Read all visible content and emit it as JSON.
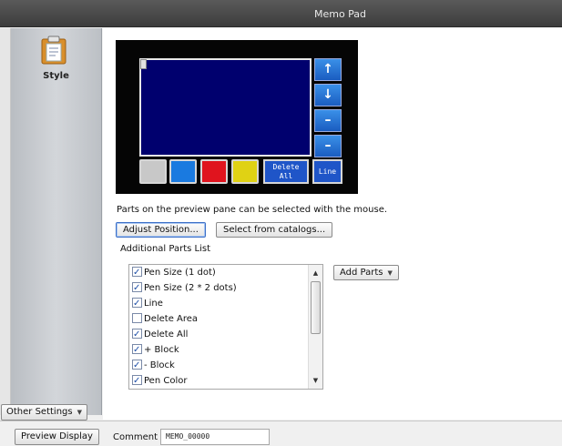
{
  "window": {
    "title": "Memo Pad"
  },
  "sidebar": {
    "style_label": "Style",
    "other_settings_label": "Other Settings"
  },
  "preview": {
    "delete_all_line1": "Delete",
    "delete_all_line2": "All",
    "line_label": "Line",
    "color_buttons": [
      "#c8c8c8",
      "#1a7ae0",
      "#e0141e",
      "#e0d214"
    ],
    "side_buttons": [
      "up-arrow-icon",
      "down-arrow-icon",
      "minus-icon",
      "minus-icon"
    ]
  },
  "main": {
    "hint": "Parts on the preview pane can be selected with the mouse.",
    "adjust_position_label": "Adjust Position...",
    "select_catalogs_label": "Select from catalogs...",
    "additional_parts_label": "Additional Parts List",
    "add_parts_label": "Add Parts",
    "parts": [
      {
        "label": "Pen Size (1 dot)",
        "checked": true
      },
      {
        "label": "Pen Size (2 * 2 dots)",
        "checked": true
      },
      {
        "label": "Line",
        "checked": true
      },
      {
        "label": "Delete Area",
        "checked": false
      },
      {
        "label": "Delete All",
        "checked": true
      },
      {
        "label": "+ Block",
        "checked": true
      },
      {
        "label": "- Block",
        "checked": true
      },
      {
        "label": "Pen Color",
        "checked": true
      }
    ]
  },
  "footer": {
    "preview_display_label": "Preview Display",
    "comment_label": "Comment",
    "comment_value": "MEMO_00000"
  }
}
